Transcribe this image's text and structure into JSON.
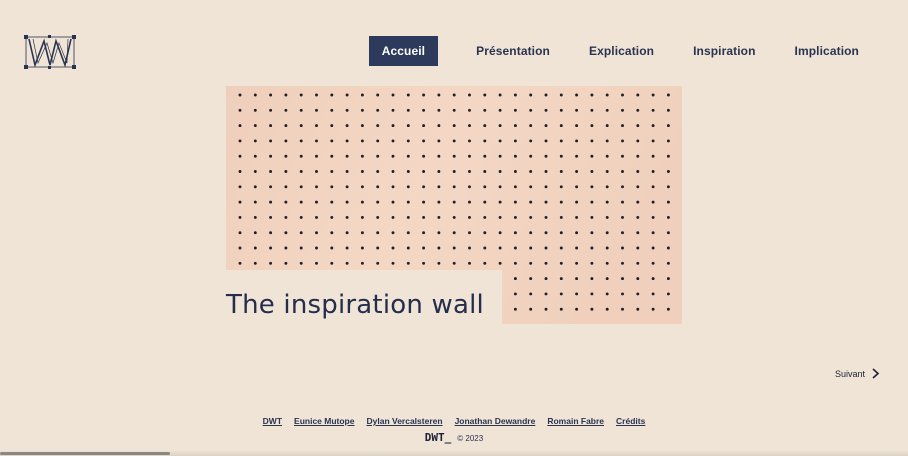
{
  "nav": {
    "items": [
      {
        "label": "Accueil",
        "active": true
      },
      {
        "label": "Présentation",
        "active": false
      },
      {
        "label": "Explication",
        "active": false
      },
      {
        "label": "Inspiration",
        "active": false
      },
      {
        "label": "Implication",
        "active": false
      }
    ]
  },
  "hero": {
    "title": "The inspiration wall"
  },
  "pager": {
    "next_label": "Suivant"
  },
  "footer": {
    "links": [
      "DWT",
      "Eunice Mutope",
      "Dylan Vercalsteren",
      "Jonathan Dewandre",
      "Romain Fabre",
      "Crédits"
    ],
    "brand": "DWT_",
    "copyright": "© 2023"
  },
  "colors": {
    "background": "#efe4d6",
    "accent": "#2e3a5c",
    "pegboard": "#f2d4c1",
    "hole": "#1e1e28"
  },
  "icons": {
    "logo": "dwt-logo-icon",
    "next": "chevron-right-icon"
  }
}
